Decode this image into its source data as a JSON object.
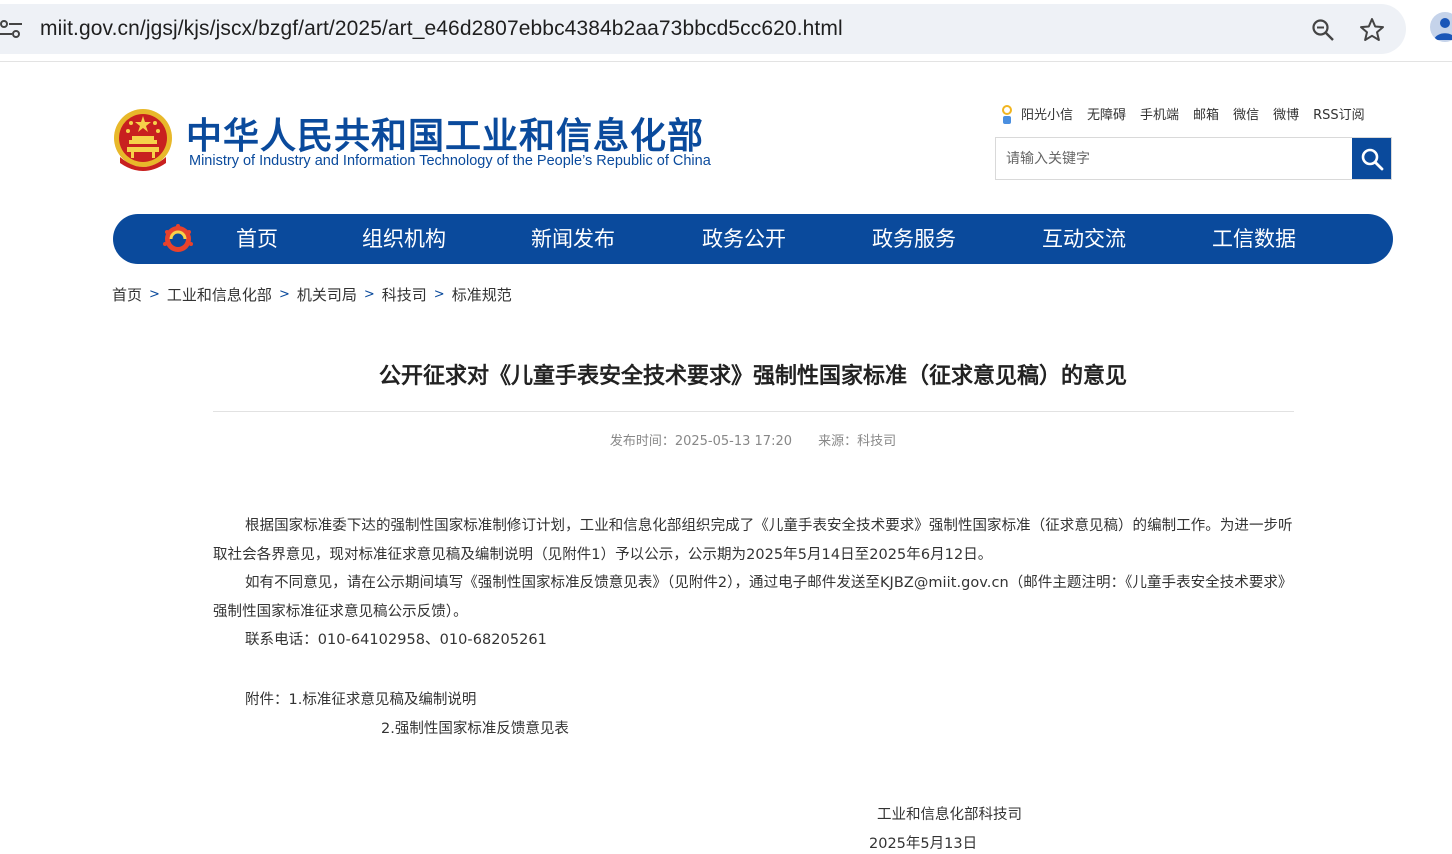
{
  "browser": {
    "url": "miit.gov.cn/jgsj/kjs/jscx/bzgf/art/2025/art_e46d2807ebbc4384b2aa73bbcd5cc620.html"
  },
  "header": {
    "title": "中华人民共和国工业和信息化部",
    "subtitle": "Ministry of Industry and Information Technology of the People’s Republic of China",
    "top_links": [
      "阳光小信",
      "无障碍",
      "手机端",
      "邮箱",
      "微信",
      "微博",
      "RSS订阅"
    ],
    "search_placeholder": "请输入关键字"
  },
  "nav": {
    "items": [
      "首页",
      "组织机构",
      "新闻发布",
      "政务公开",
      "政务服务",
      "互动交流",
      "工信数据"
    ]
  },
  "breadcrumb": [
    "首页",
    "工业和信息化部",
    "机关司局",
    "科技司",
    "标准规范"
  ],
  "article": {
    "title": "公开征求对《儿童手表安全技术要求》强制性国家标准（征求意见稿）的意见",
    "publish_time": "发布时间：2025-05-13 17:20",
    "source": "来源：科技司",
    "paragraphs": [
      "根据国家标准委下达的强制性国家标准制修订计划，工业和信息化部组织完成了《儿童手表安全技术要求》强制性国家标准（征求意见稿）的编制工作。为进一步听取社会各界意见，现对标准征求意见稿及编制说明（见附件1）予以公示，公示期为2025年5月14日至2025年6月12日。",
      "如有不同意见，请在公示期间填写《强制性国家标准反馈意见表》（见附件2），通过电子邮件发送至KJBZ@miit.gov.cn（邮件主题注明：《儿童手表安全技术要求》强制性国家标准征求意见稿公示反馈）。",
      "联系电话：010-64102958、010-68205261"
    ],
    "attachment_1": "附件：1.标准征求意见稿及编制说明",
    "attachment_2": "2.强制性国家标准反馈意见表",
    "signature": "工业和信息化部科技司",
    "date": "2025年5月13日"
  },
  "colors": {
    "brand_blue": "#0a4a9c"
  }
}
